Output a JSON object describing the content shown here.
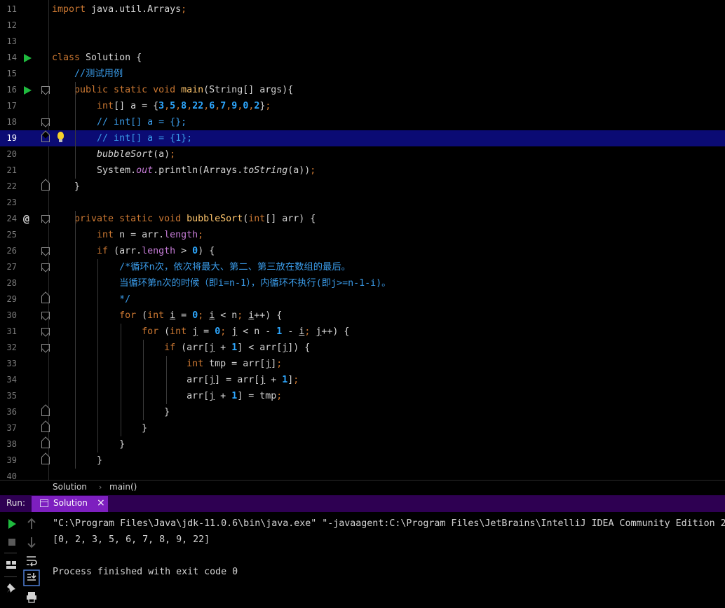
{
  "editor": {
    "lines": [
      {
        "n": "11",
        "tokens": [
          [
            "kw",
            "import "
          ],
          [
            "plain",
            "java.util.Arrays"
          ],
          [
            "kw",
            ";"
          ]
        ]
      },
      {
        "n": "12",
        "tokens": []
      },
      {
        "n": "13",
        "tokens": []
      },
      {
        "n": "14",
        "tokens": [
          [
            "kw",
            "class "
          ],
          [
            "plain",
            "Solution {"
          ]
        ]
      },
      {
        "n": "15",
        "tokens": [
          [
            "cm",
            "    //测试用例"
          ]
        ]
      },
      {
        "n": "16",
        "tokens": [
          [
            "kw",
            "    public static void "
          ],
          [
            "fn",
            "main"
          ],
          [
            "plain",
            "(String[] args){"
          ]
        ]
      },
      {
        "n": "17",
        "tokens": [
          [
            "kw",
            "        int"
          ],
          [
            "plain",
            "[] a = {"
          ],
          [
            "num",
            "3"
          ],
          [
            "kw",
            ","
          ],
          [
            "num",
            "5"
          ],
          [
            "kw",
            ","
          ],
          [
            "num",
            "8"
          ],
          [
            "kw",
            ","
          ],
          [
            "num",
            "22"
          ],
          [
            "kw",
            ","
          ],
          [
            "num",
            "6"
          ],
          [
            "kw",
            ","
          ],
          [
            "num",
            "7"
          ],
          [
            "kw",
            ","
          ],
          [
            "num",
            "9"
          ],
          [
            "kw",
            ","
          ],
          [
            "num",
            "0"
          ],
          [
            "kw",
            ","
          ],
          [
            "num",
            "2"
          ],
          [
            "plain",
            "}"
          ],
          [
            "kw",
            ";"
          ]
        ]
      },
      {
        "n": "18",
        "tokens": [
          [
            "cm",
            "        // int[] a = {};"
          ]
        ]
      },
      {
        "n": "19",
        "tokens": [
          [
            "cm",
            "        // int[] a = {1};"
          ]
        ]
      },
      {
        "n": "20",
        "tokens": [
          [
            "it",
            "        bubbleSort"
          ],
          [
            "plain",
            "(a)"
          ],
          [
            "kw",
            ";"
          ]
        ]
      },
      {
        "n": "21",
        "tokens": [
          [
            "plain",
            "        System."
          ],
          [
            "itf",
            "out"
          ],
          [
            "plain",
            ".println(Arrays."
          ],
          [
            "it",
            "toString"
          ],
          [
            "plain",
            "(a))"
          ],
          [
            "kw",
            ";"
          ]
        ]
      },
      {
        "n": "22",
        "tokens": [
          [
            "plain",
            "    }"
          ]
        ]
      },
      {
        "n": "23",
        "tokens": []
      },
      {
        "n": "24",
        "tokens": [
          [
            "kw",
            "    private static void "
          ],
          [
            "fn",
            "bubbleSort"
          ],
          [
            "plain",
            "("
          ],
          [
            "kw",
            "int"
          ],
          [
            "plain",
            "[] arr) {"
          ]
        ]
      },
      {
        "n": "25",
        "tokens": [
          [
            "kw",
            "        int "
          ],
          [
            "plain",
            "n = arr."
          ],
          [
            "fld",
            "length"
          ],
          [
            "kw",
            ";"
          ]
        ]
      },
      {
        "n": "26",
        "tokens": [
          [
            "kw",
            "        if "
          ],
          [
            "plain",
            "(arr."
          ],
          [
            "fld",
            "length"
          ],
          [
            "plain",
            " > "
          ],
          [
            "num",
            "0"
          ],
          [
            "plain",
            ") {"
          ]
        ]
      },
      {
        "n": "27",
        "tokens": [
          [
            "cm",
            "            /*循环n次，依次将最大、第二、第三放在数组的最后。"
          ]
        ]
      },
      {
        "n": "28",
        "tokens": [
          [
            "cm",
            "            当循环第n次的时候（即i=n-1），内循环不执行(即j>=n-1-i)。"
          ]
        ]
      },
      {
        "n": "29",
        "tokens": [
          [
            "cm",
            "            */"
          ]
        ]
      },
      {
        "n": "30",
        "tokens": [
          [
            "kw",
            "            for "
          ],
          [
            "plain",
            "("
          ],
          [
            "kw",
            "int "
          ],
          [
            "ul",
            "i"
          ],
          [
            "plain",
            " = "
          ],
          [
            "num",
            "0"
          ],
          [
            "kw",
            "; "
          ],
          [
            "ul",
            "i"
          ],
          [
            "plain",
            " < n"
          ],
          [
            "kw",
            "; "
          ],
          [
            "ul",
            "i"
          ],
          [
            "plain",
            "++) {"
          ]
        ]
      },
      {
        "n": "31",
        "tokens": [
          [
            "kw",
            "                for "
          ],
          [
            "plain",
            "("
          ],
          [
            "kw",
            "int "
          ],
          [
            "ul",
            "j"
          ],
          [
            "plain",
            " = "
          ],
          [
            "num",
            "0"
          ],
          [
            "kw",
            "; "
          ],
          [
            "ul",
            "j"
          ],
          [
            "plain",
            " < n - "
          ],
          [
            "num",
            "1"
          ],
          [
            "plain",
            " - "
          ],
          [
            "ul",
            "i"
          ],
          [
            "kw",
            "; "
          ],
          [
            "ul",
            "j"
          ],
          [
            "plain",
            "++) {"
          ]
        ]
      },
      {
        "n": "32",
        "tokens": [
          [
            "kw",
            "                    if "
          ],
          [
            "plain",
            "(arr["
          ],
          [
            "ul",
            "j"
          ],
          [
            "plain",
            " + "
          ],
          [
            "num",
            "1"
          ],
          [
            "plain",
            "] < arr["
          ],
          [
            "ul",
            "j"
          ],
          [
            "plain",
            "]) {"
          ]
        ]
      },
      {
        "n": "33",
        "tokens": [
          [
            "kw",
            "                        int "
          ],
          [
            "plain",
            "tmp = arr["
          ],
          [
            "ul",
            "j"
          ],
          [
            "plain",
            "]"
          ],
          [
            "kw",
            ";"
          ]
        ]
      },
      {
        "n": "34",
        "tokens": [
          [
            "plain",
            "                        arr["
          ],
          [
            "ul",
            "j"
          ],
          [
            "plain",
            "] = arr["
          ],
          [
            "ul",
            "j"
          ],
          [
            "plain",
            " + "
          ],
          [
            "num",
            "1"
          ],
          [
            "plain",
            "]"
          ],
          [
            "kw",
            ";"
          ]
        ]
      },
      {
        "n": "35",
        "tokens": [
          [
            "plain",
            "                        arr["
          ],
          [
            "ul",
            "j"
          ],
          [
            "plain",
            " + "
          ],
          [
            "num",
            "1"
          ],
          [
            "plain",
            "] = tmp"
          ],
          [
            "kw",
            ";"
          ]
        ]
      },
      {
        "n": "36",
        "tokens": [
          [
            "plain",
            "                    }"
          ]
        ]
      },
      {
        "n": "37",
        "tokens": [
          [
            "plain",
            "                }"
          ]
        ]
      },
      {
        "n": "38",
        "tokens": [
          [
            "plain",
            "            }"
          ]
        ]
      },
      {
        "n": "39",
        "tokens": [
          [
            "plain",
            "        }"
          ]
        ]
      },
      {
        "n": "40",
        "tokens": []
      }
    ],
    "highlighted_line": "19"
  },
  "breadcrumb": {
    "class": "Solution",
    "method": "main()",
    "separator": "›"
  },
  "run": {
    "label": "Run:",
    "tab_label": "Solution",
    "tab_close": "×",
    "console_lines": [
      "\"C:\\Program Files\\Java\\jdk-11.0.6\\bin\\java.exe\" \"-javaagent:C:\\Program Files\\JetBrains\\IntelliJ IDEA Community Edition 2",
      "[0, 2, 3, 5, 6, 7, 8, 9, 22]",
      "",
      "Process finished with exit code 0"
    ]
  },
  "colors": {
    "highlight": "#0b0b74",
    "run_bar": "#2e0052",
    "run_tab": "#7d1fbf",
    "keyword": "#cc7832",
    "number": "#2ea8ff",
    "comment": "#3a9be8"
  },
  "icons": [
    "run-icon",
    "at-icon",
    "fold-icon",
    "bulb-icon",
    "rerun-icon",
    "stop-icon",
    "layout-icon",
    "pin-icon",
    "up-arrow-icon",
    "down-arrow-icon",
    "soft-wrap-icon",
    "scroll-end-icon",
    "print-icon"
  ]
}
